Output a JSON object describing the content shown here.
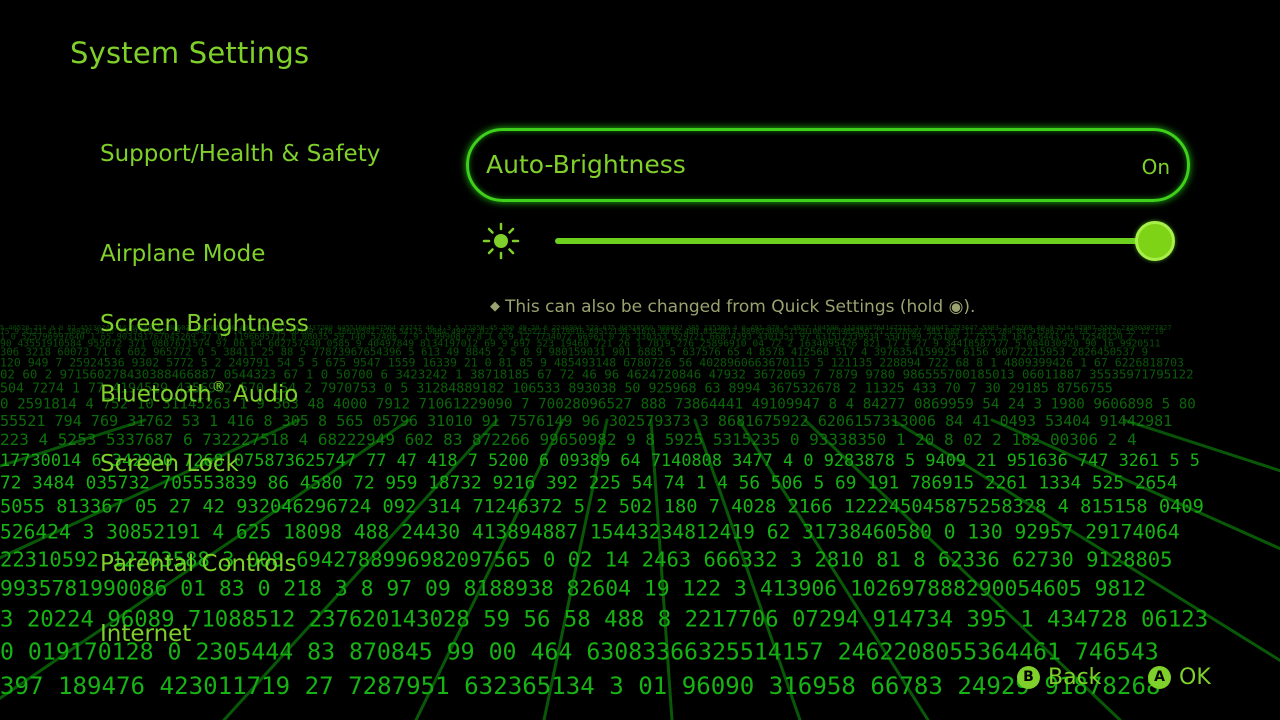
{
  "page_title": "System Settings",
  "sidebar": {
    "items": [
      {
        "label": "Support/Health & Safety"
      },
      {
        "label": "Airplane Mode"
      },
      {
        "label": "Screen Brightness"
      },
      {
        "label": "Bluetooth",
        "mark": "®",
        "suffix": " Audio"
      },
      {
        "label": "Screen Lock"
      },
      {
        "label": "Parental Controls"
      },
      {
        "label": "Internet"
      }
    ]
  },
  "auto_brightness": {
    "label": "Auto-Brightness",
    "value": "On"
  },
  "brightness_slider": {
    "level": 1.0,
    "icon": "sun-icon"
  },
  "hint": {
    "bullet": "◆",
    "text": "This can also be changed from Quick Settings (hold ◉)."
  },
  "footer": {
    "back": {
      "glyph": "B",
      "label": "Back"
    },
    "ok": {
      "glyph": "A",
      "label": "OK"
    }
  },
  "colors": {
    "accent": "#7fd02a",
    "highlight_border": "#3ed01a",
    "hint_text": "#9aa36f",
    "background": "#000000"
  }
}
